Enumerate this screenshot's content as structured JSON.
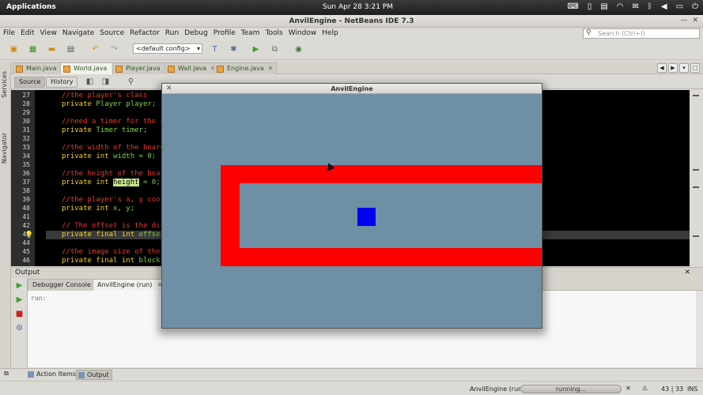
{
  "topbar": {
    "applications": "Applications",
    "clock": "Sun Apr 28  3:21 PM",
    "tray_icons": [
      "keyboard-icon",
      "phone-icon",
      "clipboard-icon",
      "wifi-icon",
      "mail-icon",
      "bluetooth-icon",
      "volume-icon",
      "battery-icon",
      "power-icon"
    ]
  },
  "window": {
    "title": "AnvilEngine - NetBeans IDE 7.3"
  },
  "menu": [
    "File",
    "Edit",
    "View",
    "Navigate",
    "Source",
    "Refactor",
    "Run",
    "Debug",
    "Profile",
    "Team",
    "Tools",
    "Window",
    "Help"
  ],
  "search": {
    "placeholder": "Search (Ctrl+I)"
  },
  "toolbar": {
    "config": "<default config>"
  },
  "tabs": [
    {
      "label": "Main.java"
    },
    {
      "label": "World.java"
    },
    {
      "label": "Player.java"
    },
    {
      "label": "Wall.java"
    },
    {
      "label": "Engine.java"
    }
  ],
  "side": {
    "services": "Services",
    "navigator": "Navigator"
  },
  "source_toolbar": {
    "source": "Source",
    "history": "History"
  },
  "code": [
    {
      "n": "27",
      "parts": [
        {
          "c": "cm",
          "t": "//the player's class"
        }
      ]
    },
    {
      "n": "28",
      "parts": [
        {
          "c": "kw",
          "t": "private "
        },
        {
          "c": "ty",
          "t": "Player player;"
        }
      ]
    },
    {
      "n": "29",
      "parts": []
    },
    {
      "n": "30",
      "parts": [
        {
          "c": "cm",
          "t": "//need a timer for the a"
        }
      ]
    },
    {
      "n": "31",
      "parts": [
        {
          "c": "kw",
          "t": "private "
        },
        {
          "c": "ty",
          "t": "Timer timer;"
        }
      ]
    },
    {
      "n": "32",
      "parts": []
    },
    {
      "n": "33",
      "parts": [
        {
          "c": "cm",
          "t": "//the width of the board"
        }
      ]
    },
    {
      "n": "34",
      "parts": [
        {
          "c": "kw",
          "t": "private int "
        },
        {
          "c": "ty",
          "t": "width = 0;"
        }
      ]
    },
    {
      "n": "35",
      "parts": []
    },
    {
      "n": "36",
      "parts": [
        {
          "c": "cm",
          "t": "//the height of the boar"
        }
      ]
    },
    {
      "n": "37",
      "parts": [
        {
          "c": "kw",
          "t": "private int "
        },
        {
          "c": "hlword",
          "t": "height"
        },
        {
          "c": "ty",
          "t": " = 0;"
        }
      ]
    },
    {
      "n": "38",
      "parts": []
    },
    {
      "n": "39",
      "parts": [
        {
          "c": "cm",
          "t": "//the player's x, y coor"
        }
      ]
    },
    {
      "n": "40",
      "parts": [
        {
          "c": "kw",
          "t": "private int "
        },
        {
          "c": "ty",
          "t": "x, y;"
        }
      ]
    },
    {
      "n": "41",
      "parts": []
    },
    {
      "n": "42",
      "parts": [
        {
          "c": "cm",
          "t": "// The offset is the dis"
        }
      ]
    },
    {
      "n": "43",
      "parts": [
        {
          "c": "kw",
          "t": "private final int "
        },
        {
          "c": "ty",
          "t": "offse"
        }
      ]
    },
    {
      "n": "44",
      "parts": []
    },
    {
      "n": "45",
      "parts": [
        {
          "c": "cm",
          "t": "//the image size of the"
        }
      ]
    },
    {
      "n": "46",
      "parts": [
        {
          "c": "kw",
          "t": "private final int "
        },
        {
          "c": "ty",
          "t": "block"
        }
      ]
    }
  ],
  "output": {
    "title": "Output",
    "tabs": [
      {
        "label": "Debugger Console"
      },
      {
        "label": "AnvilEngine (run)"
      }
    ],
    "text": "run:"
  },
  "bottom_tabs": [
    {
      "label": "Action Items"
    },
    {
      "label": "Output"
    }
  ],
  "status": {
    "task": "AnvilEngine (run)",
    "progress_text": "running...",
    "position": "43 | 33",
    "mode": "INS"
  },
  "game": {
    "title": "AnvilEngine",
    "colors": {
      "background": "#6f8fa5",
      "wall": "#fd0000",
      "player": "#0202ee"
    }
  }
}
